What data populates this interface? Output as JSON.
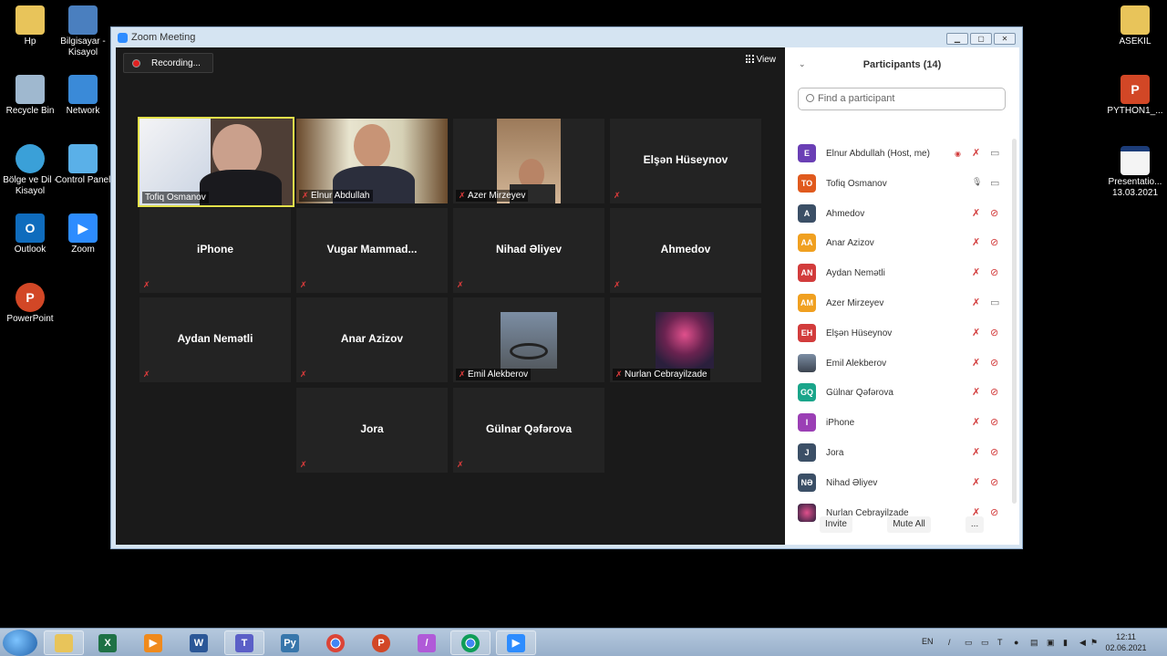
{
  "desktop": {
    "icons_left": [
      {
        "label": "Hp",
        "name": "hp-folder-icon"
      },
      {
        "label": "Bilgisayar - Kisayol",
        "name": "computer-icon"
      },
      {
        "label": "Recycle Bin",
        "name": "recycle-bin-icon"
      },
      {
        "label": "Network",
        "name": "network-icon"
      },
      {
        "label": "Bölge ve Dil - Kisayol",
        "name": "region-language-icon"
      },
      {
        "label": "Control Panel",
        "name": "control-panel-icon"
      },
      {
        "label": "Outlook",
        "name": "outlook-icon"
      },
      {
        "label": "Zoom",
        "name": "zoom-icon"
      },
      {
        "label": "PowerPoint",
        "name": "powerpoint-icon"
      }
    ],
    "icons_right": [
      {
        "label": "ASEKIL",
        "name": "asekil-folder-icon"
      },
      {
        "label": "PYTHON1_...",
        "name": "python-file-icon"
      },
      {
        "label": "Presentatio...",
        "label2": "13.03.2021",
        "name": "presentation-file-icon"
      }
    ]
  },
  "window": {
    "title": "Zoom Meeting",
    "recording_label": "Recording...",
    "view_label": "View"
  },
  "tiles": [
    {
      "name": "Tofiq Osmanov",
      "video": true,
      "active": true
    },
    {
      "name": "Elnur Abdullah",
      "video": true
    },
    {
      "name": "Azer Mirzeyev",
      "video": true
    },
    {
      "name": "Elşən Hüseynov",
      "video": false
    },
    {
      "name": "iPhone",
      "video": false
    },
    {
      "name": "Vugar  Mammad...",
      "video": false
    },
    {
      "name": "Nihad Əliyev",
      "video": false
    },
    {
      "name": "Ahmedov",
      "video": false
    },
    {
      "name": "Aydan Nemətli",
      "video": false
    },
    {
      "name": "Anar Azizov",
      "video": false
    },
    {
      "name": "Emil Alekberov",
      "video": true
    },
    {
      "name": "Nurlan Cebrayilzade",
      "video": true
    },
    {
      "name": "Jora",
      "video": false
    },
    {
      "name": "Gülnar Qəfərova",
      "video": false
    }
  ],
  "participants": {
    "title": "Participants (14)",
    "search_placeholder": "Find a participant",
    "list": [
      {
        "initials": "E",
        "name": "Elnur Abdullah (Host, me)",
        "color": "#6a3fb5"
      },
      {
        "initials": "TO",
        "name": "Tofiq Osmanov",
        "color": "#e05a1e"
      },
      {
        "initials": "A",
        "name": "Ahmedov",
        "color": "#3b4f66"
      },
      {
        "initials": "AA",
        "name": "Anar Azizov",
        "color": "#f0a020"
      },
      {
        "initials": "AN",
        "name": "Aydan Nemətli",
        "color": "#d23c3c"
      },
      {
        "initials": "AM",
        "name": "Azer Mirzeyev",
        "color": "#f0a020"
      },
      {
        "initials": "EH",
        "name": "Elşən Hüseynov",
        "color": "#d23c3c"
      },
      {
        "initials": "",
        "name": "Emil Alekberov",
        "color": "#4a5a6a"
      },
      {
        "initials": "GQ",
        "name": "Gülnar Qəfərova",
        "color": "#1aa58a"
      },
      {
        "initials": "I",
        "name": "iPhone",
        "color": "#9b3fb5"
      },
      {
        "initials": "J",
        "name": "Jora",
        "color": "#3b4f66"
      },
      {
        "initials": "NƏ",
        "name": "Nihad Əliyev",
        "color": "#3b4f66"
      },
      {
        "initials": "",
        "name": "Nurlan Cebrayilzade",
        "color": "#6a3060"
      }
    ],
    "invite_label": "Invite",
    "mute_all_label": "Mute All",
    "more_label": "..."
  },
  "taskbar": {
    "lang": "EN",
    "time": "12:11",
    "date": "02.06.2021"
  }
}
